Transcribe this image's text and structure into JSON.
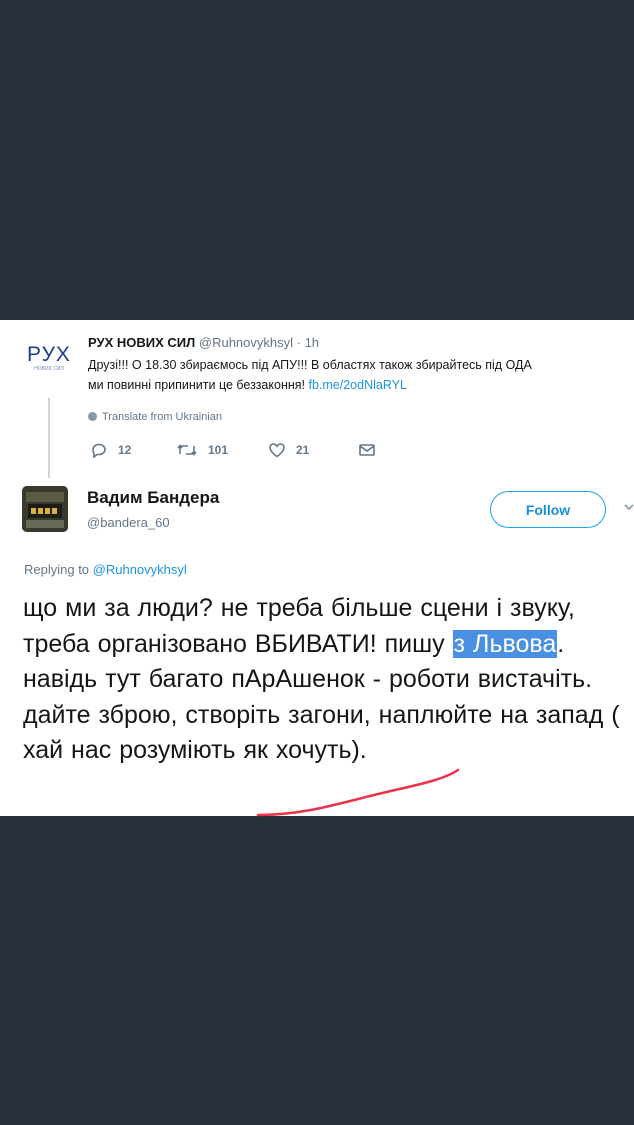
{
  "tweet1": {
    "logo_text": "РУХ",
    "logo_subtext": "НОВИХ СИЛ",
    "name": "РУХ НОВИХ СИЛ",
    "handle": "@Ruhnovykhsyl",
    "separator": " · ",
    "time": "1h",
    "text_line1": "Друзі!!! О 18.30 збираємось під АПУ!!! В областях також збирайтесь під ОДА",
    "text_line2": "ми повинні припинити це беззаконня!",
    "link": "fb.me/2odNlaRYL",
    "translate_label": "Translate from Ukrainian",
    "actions": {
      "replies": "12",
      "retweets": "101",
      "likes": "21"
    }
  },
  "tweet2": {
    "name": "Вадим Бандера",
    "handle": "@bandera_60",
    "follow_label": "Follow",
    "replying_prefix": "Replying to ",
    "replying_mention": "@Ruhnovykhsyl",
    "text_before": "що ми за люди? не треба більше сцени і звуку, треба організовано ВБИВАТИ! пишу ",
    "text_highlight": "з Львова",
    "text_after": ". навідь тут багато пАрАшенок - роботи вистачіть. дайте зброю, створіть загони, наплюйте на запад ( хай нас розуміють як хочуть)."
  },
  "colors": {
    "page_background": "#28303a",
    "link": "#1b95e0",
    "follow_border": "#1da1f2",
    "highlight": "#4a90e2",
    "annotation_underline": "#e8334a"
  }
}
